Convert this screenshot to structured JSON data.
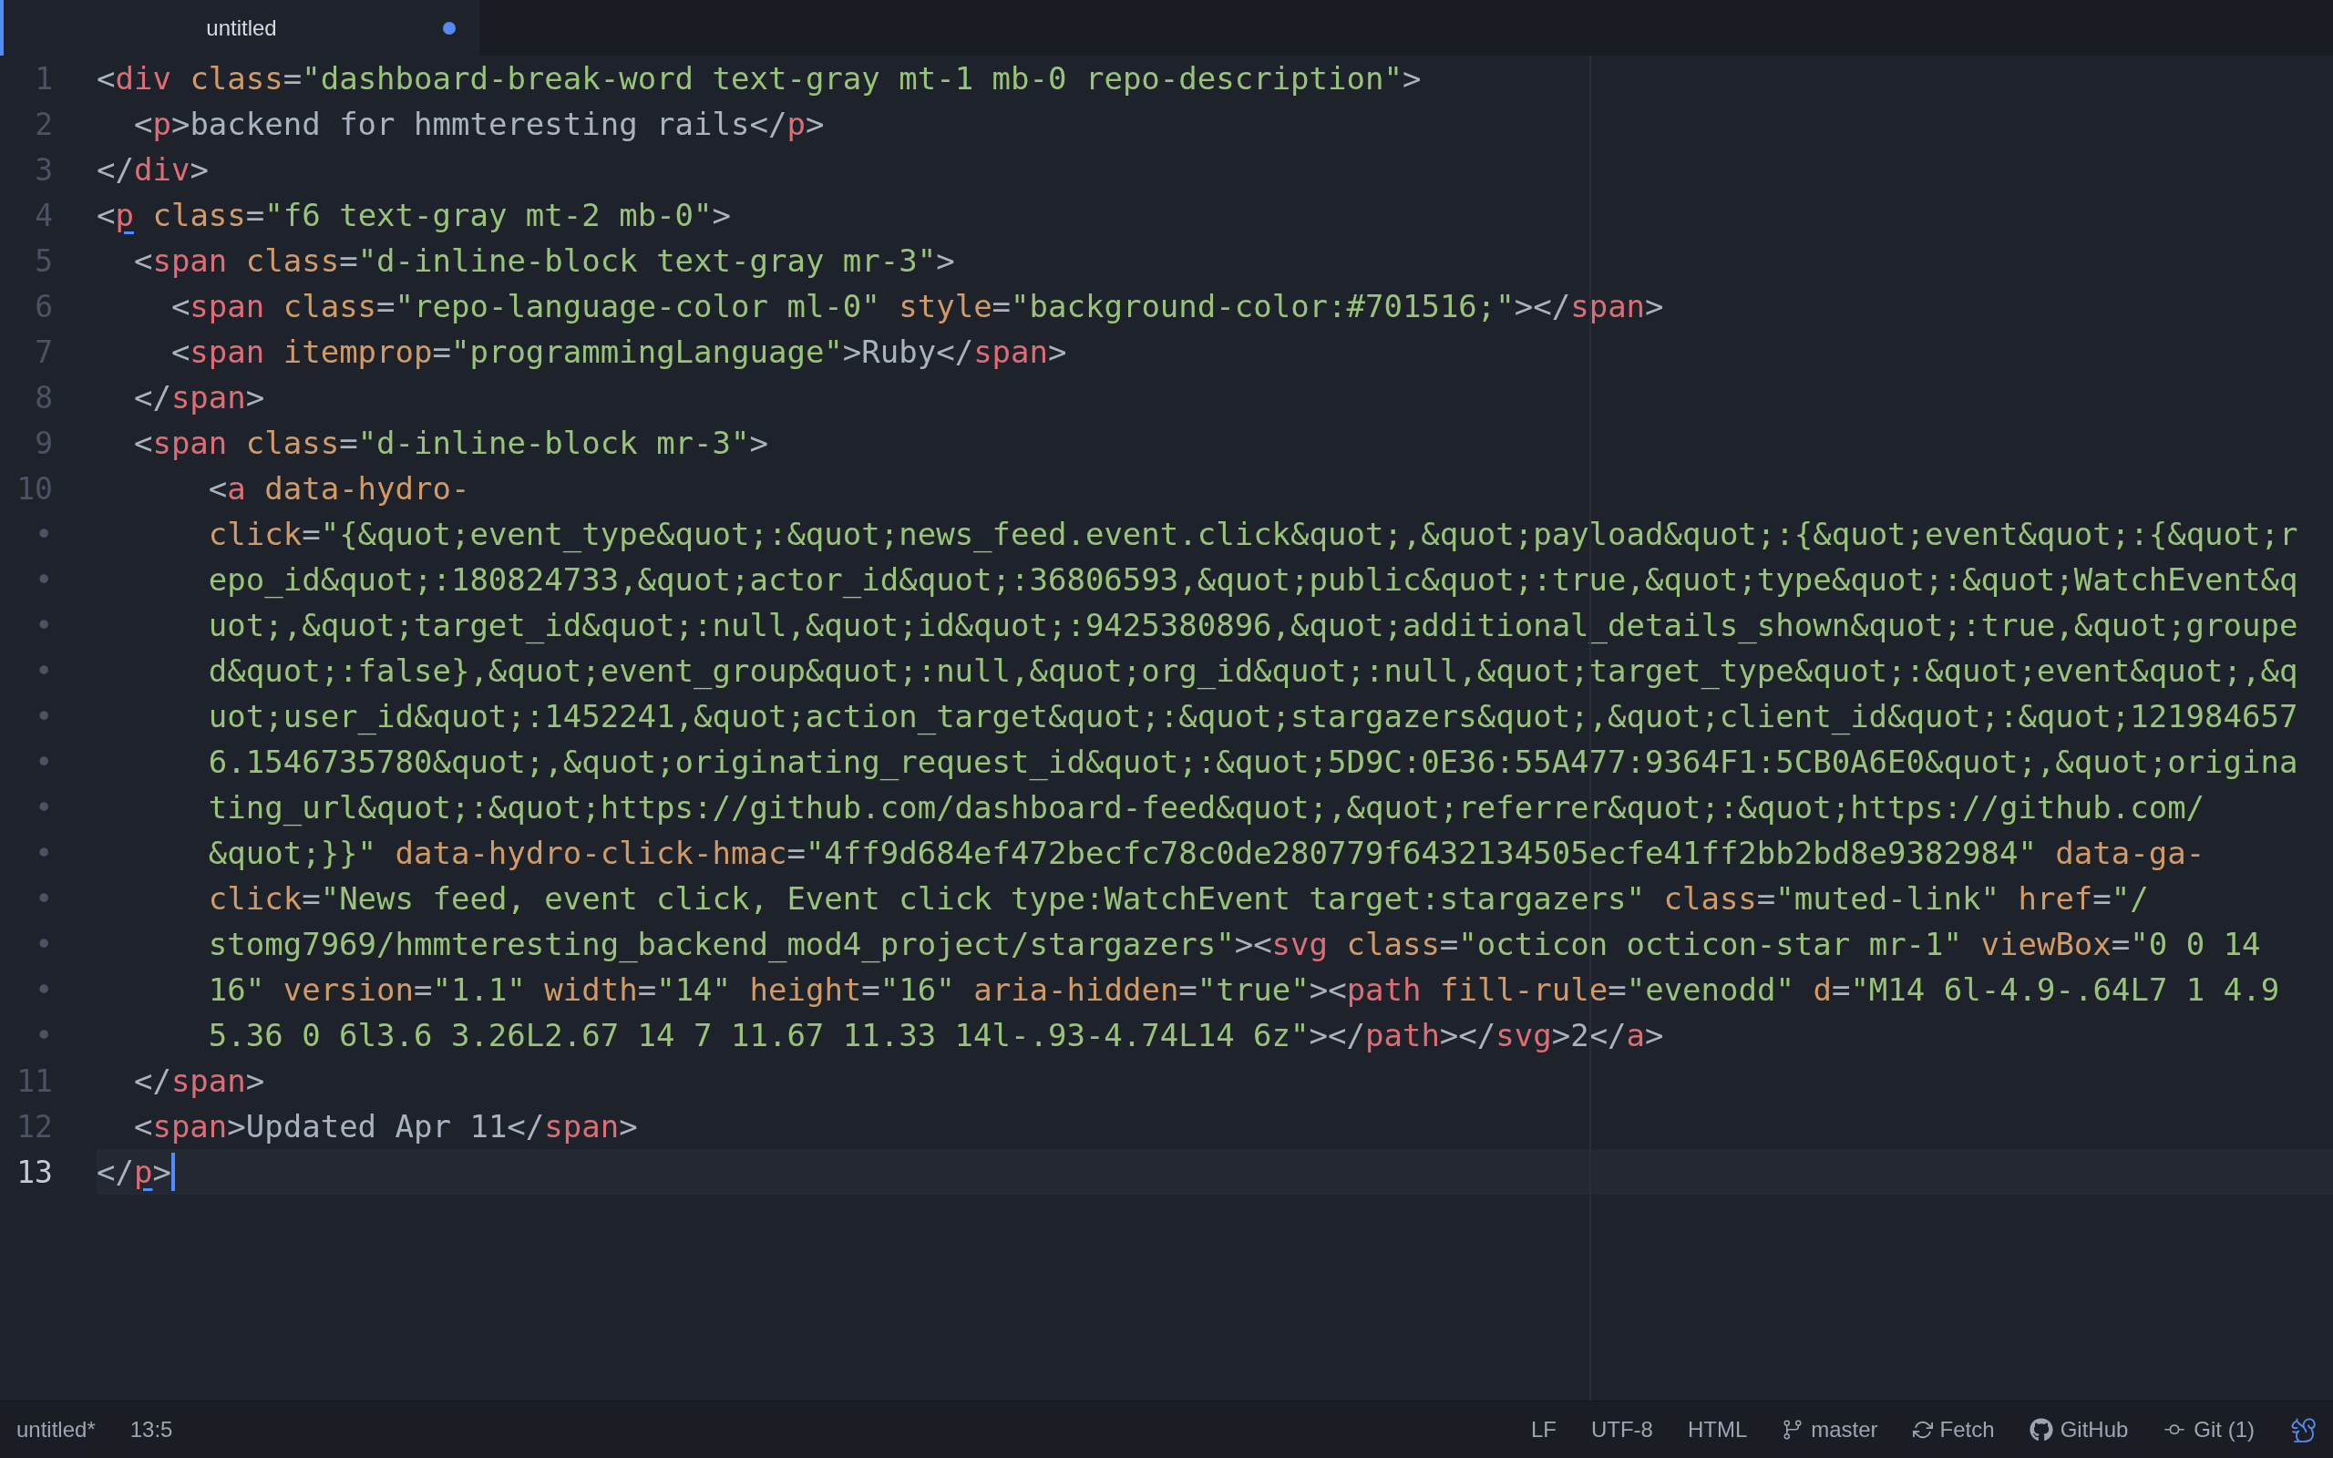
{
  "tab": {
    "title": "untitled",
    "modified": true,
    "selected": true
  },
  "rows": [
    {
      "gutter": "1",
      "current": false,
      "matched_tag": false,
      "tokens": [
        {
          "kind": "punct",
          "text": "<"
        },
        {
          "kind": "tag",
          "text": "div"
        },
        {
          "kind": "attr",
          "text": " class"
        },
        {
          "kind": "punct",
          "text": "="
        },
        {
          "kind": "string",
          "text": "\"dashboard-break-word text-gray mt-1 mb-0 repo-description\""
        },
        {
          "kind": "punct",
          "text": ">"
        }
      ]
    },
    {
      "gutter": "2",
      "current": false,
      "matched_tag": false,
      "tokens": [
        {
          "kind": "punct",
          "text": "  <"
        },
        {
          "kind": "tag",
          "text": "p"
        },
        {
          "kind": "punct",
          "text": ">backend for hmmteresting rails</"
        },
        {
          "kind": "tag",
          "text": "p"
        },
        {
          "kind": "punct",
          "text": ">"
        }
      ]
    },
    {
      "gutter": "3",
      "current": false,
      "matched_tag": false,
      "tokens": [
        {
          "kind": "punct",
          "text": "</"
        },
        {
          "kind": "tag",
          "text": "div"
        },
        {
          "kind": "punct",
          "text": ">"
        }
      ]
    },
    {
      "gutter": "4",
      "current": false,
      "matched_tag": true,
      "tokens": [
        {
          "kind": "punct",
          "text": "<"
        },
        {
          "kind": "tag",
          "text": "p"
        },
        {
          "kind": "attr",
          "text": " class"
        },
        {
          "kind": "punct",
          "text": "="
        },
        {
          "kind": "string",
          "text": "\"f6 text-gray mt-2 mb-0\""
        },
        {
          "kind": "punct",
          "text": ">"
        }
      ]
    },
    {
      "gutter": "5",
      "current": false,
      "matched_tag": false,
      "tokens": [
        {
          "kind": "punct",
          "text": "  <"
        },
        {
          "kind": "tag",
          "text": "span"
        },
        {
          "kind": "attr",
          "text": " class"
        },
        {
          "kind": "punct",
          "text": "="
        },
        {
          "kind": "string",
          "text": "\"d-inline-block text-gray mr-3\""
        },
        {
          "kind": "punct",
          "text": ">"
        }
      ]
    },
    {
      "gutter": "6",
      "current": false,
      "matched_tag": false,
      "tokens": [
        {
          "kind": "punct",
          "text": "    <"
        },
        {
          "kind": "tag",
          "text": "span"
        },
        {
          "kind": "attr",
          "text": " class"
        },
        {
          "kind": "punct",
          "text": "="
        },
        {
          "kind": "string",
          "text": "\"repo-language-color ml-0\""
        },
        {
          "kind": "attr",
          "text": " style"
        },
        {
          "kind": "punct",
          "text": "="
        },
        {
          "kind": "string",
          "text": "\"background-color:#701516;\""
        },
        {
          "kind": "punct",
          "text": "></"
        },
        {
          "kind": "tag",
          "text": "span"
        },
        {
          "kind": "punct",
          "text": ">"
        }
      ]
    },
    {
      "gutter": "7",
      "current": false,
      "matched_tag": false,
      "tokens": [
        {
          "kind": "punct",
          "text": "    <"
        },
        {
          "kind": "tag",
          "text": "span"
        },
        {
          "kind": "attr",
          "text": " itemprop"
        },
        {
          "kind": "punct",
          "text": "="
        },
        {
          "kind": "string",
          "text": "\"programmingLanguage\""
        },
        {
          "kind": "punct",
          "text": ">Ruby</"
        },
        {
          "kind": "tag",
          "text": "span"
        },
        {
          "kind": "punct",
          "text": ">"
        }
      ]
    },
    {
      "gutter": "8",
      "current": false,
      "matched_tag": false,
      "tokens": [
        {
          "kind": "punct",
          "text": "  </"
        },
        {
          "kind": "tag",
          "text": "span"
        },
        {
          "kind": "punct",
          "text": ">"
        }
      ]
    },
    {
      "gutter": "9",
      "current": false,
      "matched_tag": false,
      "tokens": [
        {
          "kind": "punct",
          "text": "  <"
        },
        {
          "kind": "tag",
          "text": "span"
        },
        {
          "kind": "attr",
          "text": " class"
        },
        {
          "kind": "punct",
          "text": "="
        },
        {
          "kind": "string",
          "text": "\"d-inline-block mr-3\""
        },
        {
          "kind": "punct",
          "text": ">"
        }
      ]
    },
    {
      "gutter": "10",
      "current": false,
      "matched_tag": false,
      "tokens": [
        {
          "kind": "punct",
          "text": "      <"
        },
        {
          "kind": "tag",
          "text": "a"
        },
        {
          "kind": "attr",
          "text": " data-hydro-"
        }
      ]
    },
    {
      "gutter": "•",
      "current": false,
      "tokens": [
        {
          "kind": "attr",
          "text": "      click"
        },
        {
          "kind": "punct",
          "text": "="
        },
        {
          "kind": "string",
          "text": "\"{&quot;event_type&quot;:&quot;news_feed.event.click&quot;,&quot;payload&quot;:{&quot;event&quot;:{&quot;r"
        }
      ]
    },
    {
      "gutter": "•",
      "current": false,
      "tokens": [
        {
          "kind": "string",
          "text": "      epo_id&quot;:180824733,&quot;actor_id&quot;:36806593,&quot;public&quot;:true,&quot;type&quot;:&quot;WatchEvent&q"
        }
      ]
    },
    {
      "gutter": "•",
      "current": false,
      "tokens": [
        {
          "kind": "string",
          "text": "      uot;,&quot;target_id&quot;:null,&quot;id&quot;:9425380896,&quot;additional_details_shown&quot;:true,&quot;groupe"
        }
      ]
    },
    {
      "gutter": "•",
      "current": false,
      "tokens": [
        {
          "kind": "string",
          "text": "      d&quot;:false},&quot;event_group&quot;:null,&quot;org_id&quot;:null,&quot;target_type&quot;:&quot;event&quot;,&q"
        }
      ]
    },
    {
      "gutter": "•",
      "current": false,
      "tokens": [
        {
          "kind": "string",
          "text": "      uot;user_id&quot;:1452241,&quot;action_target&quot;:&quot;stargazers&quot;,&quot;client_id&quot;:&quot;121984657"
        }
      ]
    },
    {
      "gutter": "•",
      "current": false,
      "tokens": [
        {
          "kind": "string",
          "text": "      6.1546735780&quot;,&quot;originating_request_id&quot;:&quot;5D9C:0E36:55A477:9364F1:5CB0A6E0&quot;,&quot;origina"
        }
      ]
    },
    {
      "gutter": "•",
      "current": false,
      "tokens": [
        {
          "kind": "string",
          "text": "      ting_url&quot;:&quot;https://github.com/dashboard-feed&quot;,&quot;referrer&quot;:&quot;https://github.com/"
        }
      ]
    },
    {
      "gutter": "•",
      "current": false,
      "tokens": [
        {
          "kind": "string",
          "text": "      &quot;}}\""
        },
        {
          "kind": "attr",
          "text": " data-hydro-click-hmac"
        },
        {
          "kind": "punct",
          "text": "="
        },
        {
          "kind": "string",
          "text": "\"4ff9d684ef472becfc78c0de280779f6432134505ecfe41ff2bb2bd8e9382984\""
        },
        {
          "kind": "attr",
          "text": " data-ga-"
        }
      ]
    },
    {
      "gutter": "•",
      "current": false,
      "tokens": [
        {
          "kind": "attr",
          "text": "      click"
        },
        {
          "kind": "punct",
          "text": "="
        },
        {
          "kind": "string",
          "text": "\"News feed, event click, Event click type:WatchEvent target:stargazers\""
        },
        {
          "kind": "attr",
          "text": " class"
        },
        {
          "kind": "punct",
          "text": "="
        },
        {
          "kind": "string",
          "text": "\"muted-link\""
        },
        {
          "kind": "attr",
          "text": " href"
        },
        {
          "kind": "punct",
          "text": "="
        },
        {
          "kind": "string",
          "text": "\"/"
        }
      ]
    },
    {
      "gutter": "•",
      "current": false,
      "matched_tag": false,
      "tokens": [
        {
          "kind": "string",
          "text": "      stomg7969/hmmteresting_backend_mod4_project/stargazers\""
        },
        {
          "kind": "punct",
          "text": "><"
        },
        {
          "kind": "tag",
          "text": "svg"
        },
        {
          "kind": "attr",
          "text": " class"
        },
        {
          "kind": "punct",
          "text": "="
        },
        {
          "kind": "string",
          "text": "\"octicon octicon-star mr-1\""
        },
        {
          "kind": "attr",
          "text": " viewBox"
        },
        {
          "kind": "punct",
          "text": "="
        },
        {
          "kind": "string",
          "text": "\"0 0 14"
        }
      ]
    },
    {
      "gutter": "•",
      "current": false,
      "matched_tag": false,
      "tokens": [
        {
          "kind": "string",
          "text": "      16\""
        },
        {
          "kind": "attr",
          "text": " version"
        },
        {
          "kind": "punct",
          "text": "="
        },
        {
          "kind": "string",
          "text": "\"1.1\""
        },
        {
          "kind": "attr",
          "text": " width"
        },
        {
          "kind": "punct",
          "text": "="
        },
        {
          "kind": "string",
          "text": "\"14\""
        },
        {
          "kind": "attr",
          "text": " height"
        },
        {
          "kind": "punct",
          "text": "="
        },
        {
          "kind": "string",
          "text": "\"16\""
        },
        {
          "kind": "attr",
          "text": " aria-hidden"
        },
        {
          "kind": "punct",
          "text": "="
        },
        {
          "kind": "string",
          "text": "\"true\""
        },
        {
          "kind": "punct",
          "text": "><"
        },
        {
          "kind": "tag",
          "text": "path"
        },
        {
          "kind": "attr",
          "text": " fill-rule"
        },
        {
          "kind": "punct",
          "text": "="
        },
        {
          "kind": "string",
          "text": "\"evenodd\""
        },
        {
          "kind": "attr",
          "text": " d"
        },
        {
          "kind": "punct",
          "text": "="
        },
        {
          "kind": "string",
          "text": "\"M14 6l-4.9-.64L7 1 4.9"
        }
      ]
    },
    {
      "gutter": "•",
      "current": false,
      "matched_tag": false,
      "tokens": [
        {
          "kind": "string",
          "text": "      5.36 0 6l3.6 3.26L2.67 14 7 11.67 11.33 14l-.93-4.74L14 6z\""
        },
        {
          "kind": "punct",
          "text": "></"
        },
        {
          "kind": "tag",
          "text": "path"
        },
        {
          "kind": "punct",
          "text": "></"
        },
        {
          "kind": "tag",
          "text": "svg"
        },
        {
          "kind": "punct",
          "text": ">2</"
        },
        {
          "kind": "tag",
          "text": "a"
        },
        {
          "kind": "punct",
          "text": ">"
        }
      ]
    },
    {
      "gutter": "11",
      "current": false,
      "matched_tag": false,
      "tokens": [
        {
          "kind": "punct",
          "text": "  </"
        },
        {
          "kind": "tag",
          "text": "span"
        },
        {
          "kind": "punct",
          "text": ">"
        }
      ]
    },
    {
      "gutter": "12",
      "current": false,
      "matched_tag": false,
      "tokens": [
        {
          "kind": "punct",
          "text": "  <"
        },
        {
          "kind": "tag",
          "text": "span"
        },
        {
          "kind": "punct",
          "text": ">Updated Apr 11</"
        },
        {
          "kind": "tag",
          "text": "span"
        },
        {
          "kind": "punct",
          "text": ">"
        }
      ]
    },
    {
      "gutter": "13",
      "current": true,
      "matched_tag": true,
      "tokens": [
        {
          "kind": "punct",
          "text": "</"
        },
        {
          "kind": "tag",
          "text": "p"
        },
        {
          "kind": "punct",
          "text": ">"
        }
      ]
    }
  ],
  "status_bar": {
    "left": [
      "untitled*",
      "13:5"
    ],
    "right": [
      {
        "kind": "plain",
        "text": "LF"
      },
      {
        "kind": "plain",
        "text": "UTF-8"
      },
      {
        "kind": "plain",
        "text": "HTML"
      },
      {
        "kind": "branch",
        "text": "master"
      },
      {
        "kind": "fetch",
        "text": "Fetch"
      },
      {
        "kind": "github",
        "text": "GitHub"
      },
      {
        "kind": "git",
        "text": "Git (1)"
      },
      {
        "kind": "squirrel"
      }
    ]
  }
}
